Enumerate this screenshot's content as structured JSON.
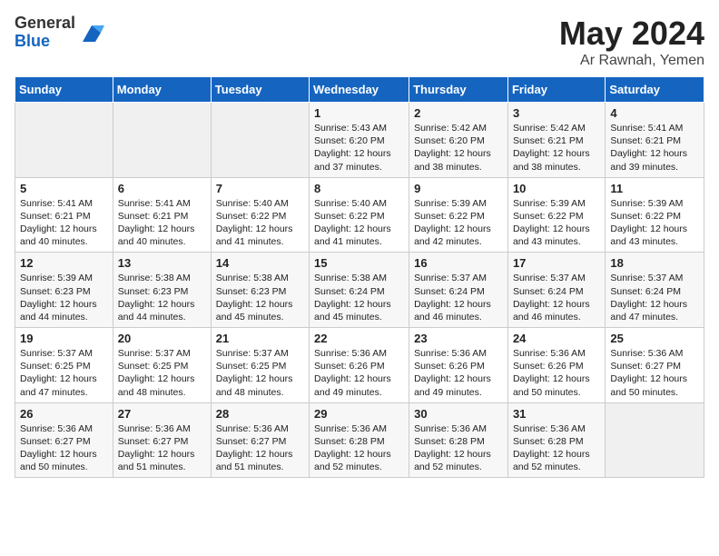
{
  "header": {
    "logo_general": "General",
    "logo_blue": "Blue",
    "month_title": "May 2024",
    "location": "Ar Rawnah, Yemen"
  },
  "weekdays": [
    "Sunday",
    "Monday",
    "Tuesday",
    "Wednesday",
    "Thursday",
    "Friday",
    "Saturday"
  ],
  "weeks": [
    [
      {
        "day": "",
        "info": ""
      },
      {
        "day": "",
        "info": ""
      },
      {
        "day": "",
        "info": ""
      },
      {
        "day": "1",
        "info": "Sunrise: 5:43 AM\nSunset: 6:20 PM\nDaylight: 12 hours\nand 37 minutes."
      },
      {
        "day": "2",
        "info": "Sunrise: 5:42 AM\nSunset: 6:20 PM\nDaylight: 12 hours\nand 38 minutes."
      },
      {
        "day": "3",
        "info": "Sunrise: 5:42 AM\nSunset: 6:21 PM\nDaylight: 12 hours\nand 38 minutes."
      },
      {
        "day": "4",
        "info": "Sunrise: 5:41 AM\nSunset: 6:21 PM\nDaylight: 12 hours\nand 39 minutes."
      }
    ],
    [
      {
        "day": "5",
        "info": "Sunrise: 5:41 AM\nSunset: 6:21 PM\nDaylight: 12 hours\nand 40 minutes."
      },
      {
        "day": "6",
        "info": "Sunrise: 5:41 AM\nSunset: 6:21 PM\nDaylight: 12 hours\nand 40 minutes."
      },
      {
        "day": "7",
        "info": "Sunrise: 5:40 AM\nSunset: 6:22 PM\nDaylight: 12 hours\nand 41 minutes."
      },
      {
        "day": "8",
        "info": "Sunrise: 5:40 AM\nSunset: 6:22 PM\nDaylight: 12 hours\nand 41 minutes."
      },
      {
        "day": "9",
        "info": "Sunrise: 5:39 AM\nSunset: 6:22 PM\nDaylight: 12 hours\nand 42 minutes."
      },
      {
        "day": "10",
        "info": "Sunrise: 5:39 AM\nSunset: 6:22 PM\nDaylight: 12 hours\nand 43 minutes."
      },
      {
        "day": "11",
        "info": "Sunrise: 5:39 AM\nSunset: 6:22 PM\nDaylight: 12 hours\nand 43 minutes."
      }
    ],
    [
      {
        "day": "12",
        "info": "Sunrise: 5:39 AM\nSunset: 6:23 PM\nDaylight: 12 hours\nand 44 minutes."
      },
      {
        "day": "13",
        "info": "Sunrise: 5:38 AM\nSunset: 6:23 PM\nDaylight: 12 hours\nand 44 minutes."
      },
      {
        "day": "14",
        "info": "Sunrise: 5:38 AM\nSunset: 6:23 PM\nDaylight: 12 hours\nand 45 minutes."
      },
      {
        "day": "15",
        "info": "Sunrise: 5:38 AM\nSunset: 6:24 PM\nDaylight: 12 hours\nand 45 minutes."
      },
      {
        "day": "16",
        "info": "Sunrise: 5:37 AM\nSunset: 6:24 PM\nDaylight: 12 hours\nand 46 minutes."
      },
      {
        "day": "17",
        "info": "Sunrise: 5:37 AM\nSunset: 6:24 PM\nDaylight: 12 hours\nand 46 minutes."
      },
      {
        "day": "18",
        "info": "Sunrise: 5:37 AM\nSunset: 6:24 PM\nDaylight: 12 hours\nand 47 minutes."
      }
    ],
    [
      {
        "day": "19",
        "info": "Sunrise: 5:37 AM\nSunset: 6:25 PM\nDaylight: 12 hours\nand 47 minutes."
      },
      {
        "day": "20",
        "info": "Sunrise: 5:37 AM\nSunset: 6:25 PM\nDaylight: 12 hours\nand 48 minutes."
      },
      {
        "day": "21",
        "info": "Sunrise: 5:37 AM\nSunset: 6:25 PM\nDaylight: 12 hours\nand 48 minutes."
      },
      {
        "day": "22",
        "info": "Sunrise: 5:36 AM\nSunset: 6:26 PM\nDaylight: 12 hours\nand 49 minutes."
      },
      {
        "day": "23",
        "info": "Sunrise: 5:36 AM\nSunset: 6:26 PM\nDaylight: 12 hours\nand 49 minutes."
      },
      {
        "day": "24",
        "info": "Sunrise: 5:36 AM\nSunset: 6:26 PM\nDaylight: 12 hours\nand 50 minutes."
      },
      {
        "day": "25",
        "info": "Sunrise: 5:36 AM\nSunset: 6:27 PM\nDaylight: 12 hours\nand 50 minutes."
      }
    ],
    [
      {
        "day": "26",
        "info": "Sunrise: 5:36 AM\nSunset: 6:27 PM\nDaylight: 12 hours\nand 50 minutes."
      },
      {
        "day": "27",
        "info": "Sunrise: 5:36 AM\nSunset: 6:27 PM\nDaylight: 12 hours\nand 51 minutes."
      },
      {
        "day": "28",
        "info": "Sunrise: 5:36 AM\nSunset: 6:27 PM\nDaylight: 12 hours\nand 51 minutes."
      },
      {
        "day": "29",
        "info": "Sunrise: 5:36 AM\nSunset: 6:28 PM\nDaylight: 12 hours\nand 52 minutes."
      },
      {
        "day": "30",
        "info": "Sunrise: 5:36 AM\nSunset: 6:28 PM\nDaylight: 12 hours\nand 52 minutes."
      },
      {
        "day": "31",
        "info": "Sunrise: 5:36 AM\nSunset: 6:28 PM\nDaylight: 12 hours\nand 52 minutes."
      },
      {
        "day": "",
        "info": ""
      }
    ]
  ]
}
